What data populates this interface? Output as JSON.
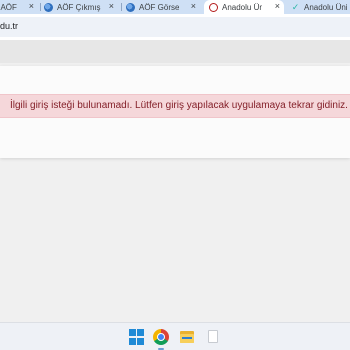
{
  "browser": {
    "tabs": [
      {
        "title": "- AÖF",
        "favicon": "globe-icon",
        "active": false
      },
      {
        "title": "AÖF Çıkmış S",
        "favicon": "globe-icon",
        "active": false
      },
      {
        "title": "AÖF Görsel",
        "favicon": "globe-icon",
        "active": false
      },
      {
        "title": "Anadolu Üni",
        "favicon": "anadolu-logo-icon",
        "active": true
      },
      {
        "title": "Anadolu Üni",
        "favicon": "extension-icon",
        "active": false
      }
    ],
    "close_glyph": "×",
    "address": "du.tr"
  },
  "page": {
    "alert_text": "İlgili giriş isteği bulunamadı. Lütfen giriş yapılacak uygulamaya tekrar gidiniz."
  },
  "taskbar": {
    "icons": [
      "windows-start-icon",
      "chrome-icon",
      "file-explorer-icon",
      "document-icon"
    ],
    "active": "chrome-icon"
  },
  "colors": {
    "alert_background": "#f5d7da",
    "alert_text": "#842029",
    "tab_strip": "#cfe0f5",
    "accent": "#1f8ad6"
  }
}
